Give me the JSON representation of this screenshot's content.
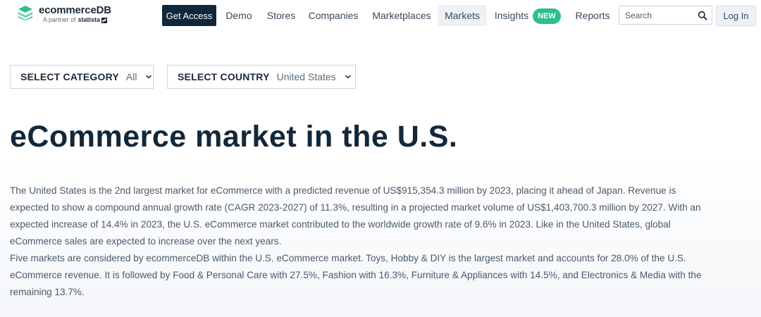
{
  "header": {
    "logo": {
      "name": "ecommerceDB",
      "partner_prefix": "A partner of",
      "partner_brand": "statista"
    },
    "get_access_label": "Get Access",
    "nav": {
      "demo": "Demo",
      "stores": "Stores",
      "companies": "Companies",
      "marketplaces": "Marketplaces",
      "markets": "Markets",
      "insights": "Insights",
      "insights_badge": "NEW",
      "reports": "Reports"
    },
    "search": {
      "placeholder": "Search"
    },
    "login_label": "Log In"
  },
  "filters": {
    "category": {
      "label": "SELECT CATEGORY",
      "value": "All"
    },
    "country": {
      "label": "SELECT COUNTRY",
      "value": "United States"
    }
  },
  "main": {
    "title": "eCommerce market in the U.S.",
    "paragraph_1": "The United States is the 2nd largest market for eCommerce with a predicted revenue of US$915,354.3 million by 2023, placing it ahead of Japan. Revenue is expected to show a compound annual growth rate (CAGR 2023-2027) of 11.3%, resulting in a projected market volume of US$1,403,700.3 million by 2027. With an expected increase of 14.4% in 2023, the U.S. eCommerce market contributed to the worldwide growth rate of 9.6% in 2023. Like in the United States, global eCommerce sales are expected to increase over the next years.",
    "paragraph_2": "Five markets are considered by ecommerceDB within the U.S. eCommerce market. Toys, Hobby & DIY is the largest market and accounts for 28.0% of the U.S. eCommerce revenue. It is followed by Food & Personal Care with 27.5%, Fashion with 16.3%, Furniture & Appliances with 14.5%, and Electronics & Media with the remaining 13.7%."
  },
  "colors": {
    "brand_dark": "#0f2738",
    "accent_green": "#2bbf92",
    "text_body": "#4a5a6a"
  },
  "icons": {
    "logo": "ecommercedb-logo-icon",
    "search": "search-icon",
    "dropdown": "chevron-down-icon"
  }
}
